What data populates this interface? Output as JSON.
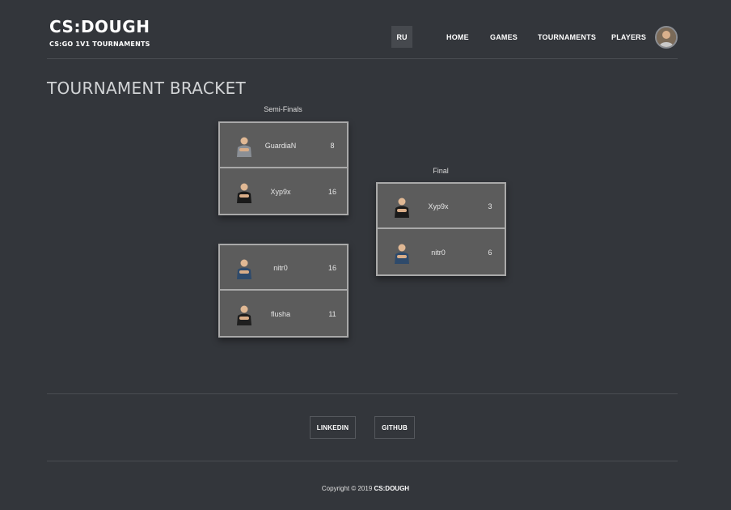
{
  "header": {
    "brand_title": "CS:DOUGH",
    "brand_subtitle": "CS:GO 1V1 TOURNAMENTS",
    "lang_button": "RU",
    "nav": [
      {
        "label": "HOME"
      },
      {
        "label": "GAMES"
      },
      {
        "label": "TOURNAMENTS"
      },
      {
        "label": "PLAYERS"
      }
    ]
  },
  "page_title": "TOURNAMENT BRACKET",
  "bracket": {
    "semifinals_label": "Semi-Finals",
    "final_label": "Final",
    "semifinals": [
      {
        "players": [
          {
            "name": "GuardiaN",
            "score": "8",
            "shirt": "#8a8f96"
          },
          {
            "name": "Xyp9x",
            "score": "16",
            "shirt": "#1a1a1a"
          }
        ]
      },
      {
        "players": [
          {
            "name": "nitr0",
            "score": "16",
            "shirt": "#2e4a6b"
          },
          {
            "name": "flusha",
            "score": "11",
            "shirt": "#1f1f1f"
          }
        ]
      }
    ],
    "final": {
      "players": [
        {
          "name": "Xyp9x",
          "score": "3",
          "shirt": "#1a1a1a"
        },
        {
          "name": "nitr0",
          "score": "6",
          "shirt": "#2e4a6b"
        }
      ]
    }
  },
  "footer": {
    "linkedin": "LINKEDIN",
    "github": "GITHUB",
    "copyright_prefix": "Copyright © 2019",
    "copyright_brand": "CS:DOUGH"
  }
}
